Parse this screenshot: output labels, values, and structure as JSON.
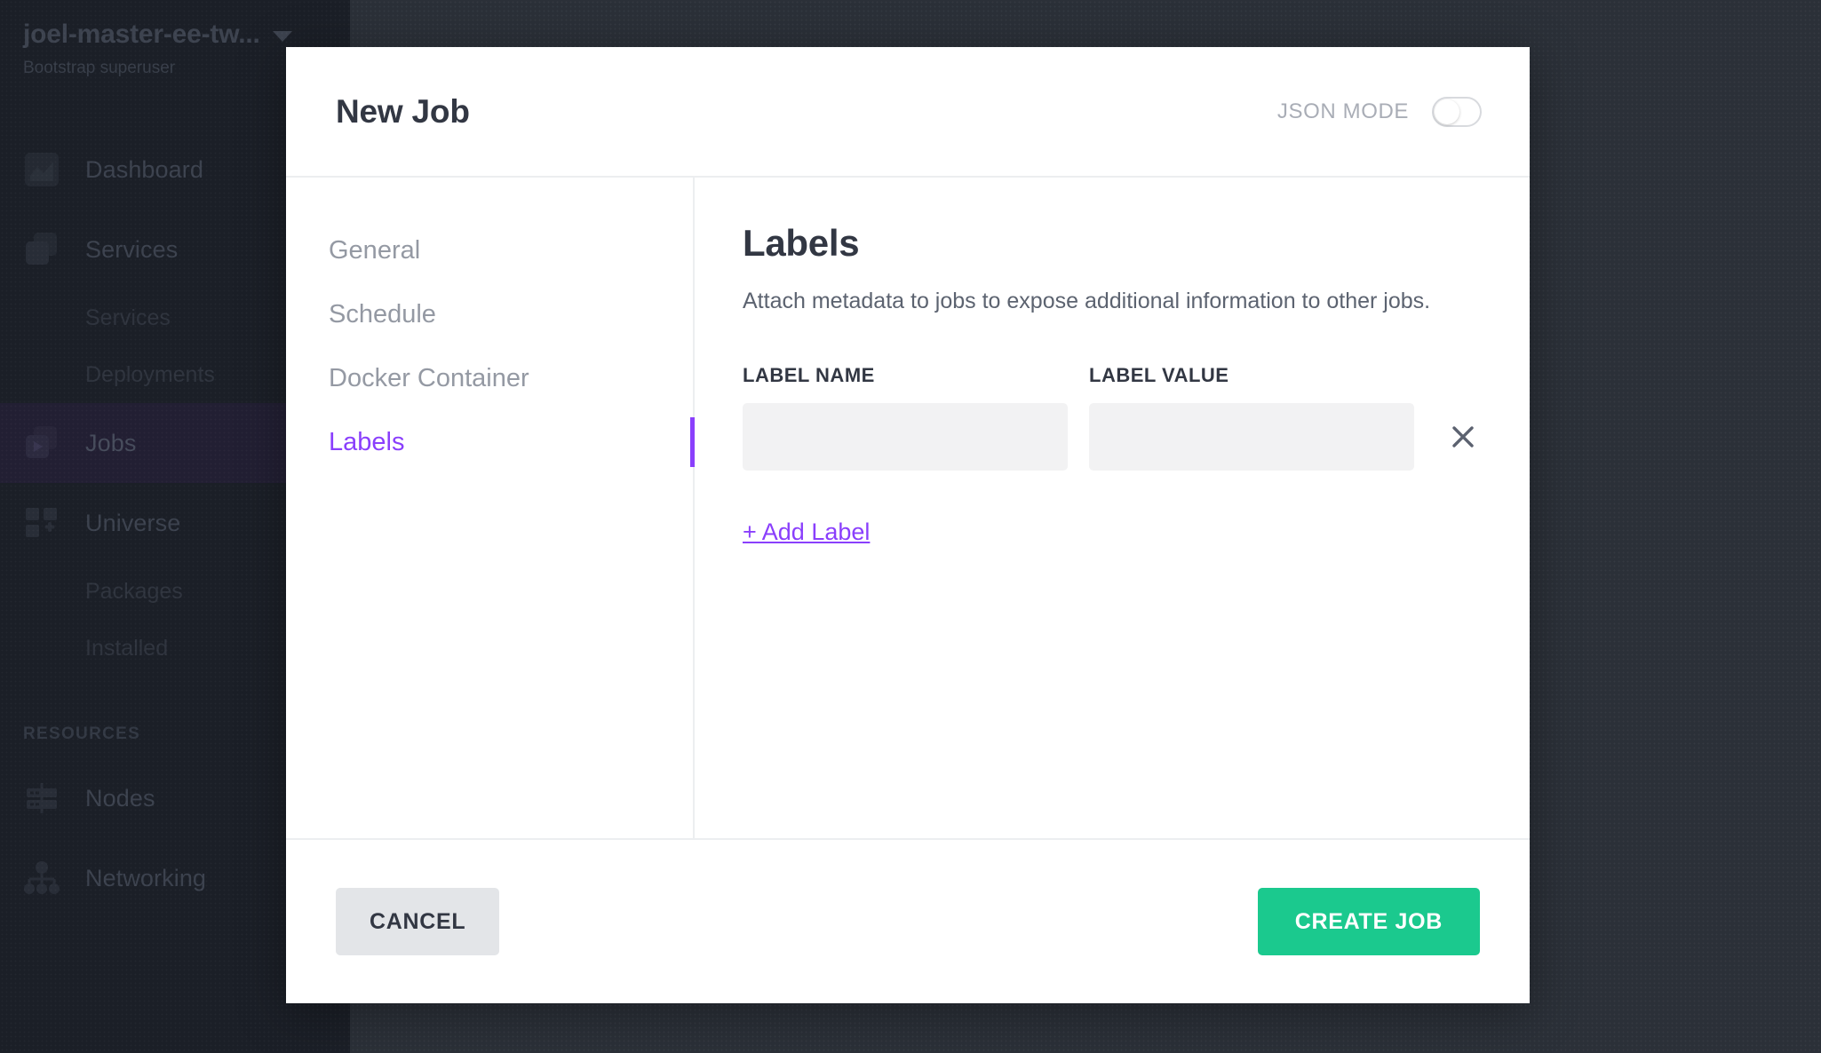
{
  "colors": {
    "accent_purple": "#8a3ffc",
    "primary_green": "#1bc98e",
    "sidebar_bg": "#1b1f27",
    "backdrop": "#2b3038",
    "active_nav": "#221f33"
  },
  "sidebar": {
    "cluster_name": "joel-master-ee-tw...",
    "cluster_subtitle": "Bootstrap superuser",
    "caret_icon": "chevron-down-icon",
    "items": [
      {
        "label": "Dashboard",
        "icon": "dashboard-icon",
        "active": false,
        "children": []
      },
      {
        "label": "Services",
        "icon": "services-icon",
        "active": false,
        "children": [
          "Services",
          "Deployments"
        ]
      },
      {
        "label": "Jobs",
        "icon": "jobs-icon",
        "active": true,
        "children": []
      },
      {
        "label": "Universe",
        "icon": "universe-icon",
        "active": false,
        "children": [
          "Packages",
          "Installed"
        ]
      }
    ],
    "section_title": "RESOURCES",
    "resources": [
      {
        "label": "Nodes",
        "icon": "nodes-icon"
      },
      {
        "label": "Networking",
        "icon": "networking-icon"
      }
    ]
  },
  "modal": {
    "title": "New Job",
    "json_mode": {
      "label": "JSON MODE",
      "enabled": false
    },
    "tabs": [
      {
        "label": "General",
        "active": false
      },
      {
        "label": "Schedule",
        "active": false
      },
      {
        "label": "Docker Container",
        "active": false
      },
      {
        "label": "Labels",
        "active": true
      }
    ],
    "pane": {
      "title": "Labels",
      "description": "Attach metadata to jobs to expose additional information to other jobs.",
      "columns": {
        "name": "LABEL NAME",
        "value": "LABEL VALUE"
      },
      "rows": [
        {
          "name": "",
          "value": "",
          "name_placeholder": "",
          "value_placeholder": "",
          "remove_icon": "close-icon"
        }
      ],
      "add_label": "+ Add Label"
    },
    "footer": {
      "cancel": "CANCEL",
      "submit": "CREATE JOB"
    }
  }
}
